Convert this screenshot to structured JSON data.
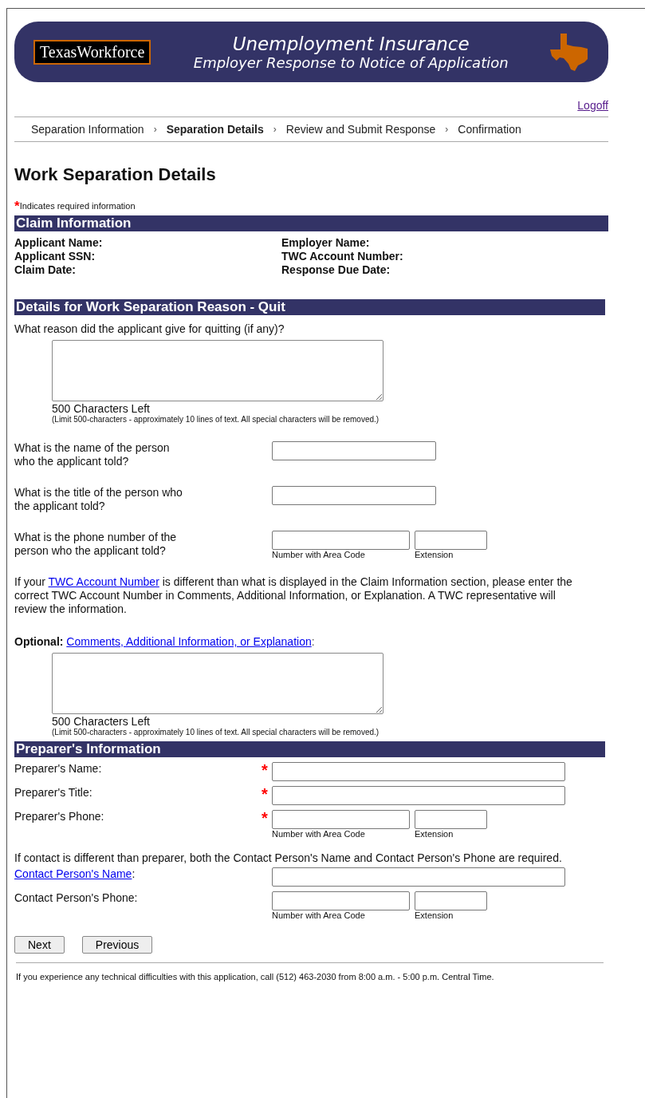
{
  "header": {
    "logo": "TexasWorkforce",
    "title": "Unemployment Insurance",
    "subtitle": "Employer Response to Notice of Application"
  },
  "logoff": "Logoff",
  "steps": [
    {
      "label": "Separation Information",
      "selected": false
    },
    {
      "label": "Separation Details",
      "selected": true
    },
    {
      "label": "Review and Submit Response",
      "selected": false
    },
    {
      "label": "Confirmation",
      "selected": false
    }
  ],
  "step_separator": "›",
  "page_title": "Work Separation Details",
  "required_note": {
    "mark": "*",
    "text": "Indicates required information"
  },
  "claim_info": {
    "heading": "Claim Information",
    "left": [
      "Applicant Name:",
      "Applicant SSN:",
      "Claim Date:"
    ],
    "right": [
      "Employer Name:",
      "TWC Account Number:",
      "Response Due Date:"
    ]
  },
  "quit_section": {
    "heading": "Details for Work Separation Reason - Quit",
    "reason": {
      "label": "What reason did the applicant give for quitting (if any)?",
      "counter": "500 Characters Left",
      "limit": "(Limit 500-characters - approximately 10 lines of text. All special characters will be removed.)"
    },
    "questions": [
      {
        "kind": "text",
        "label": "What is the name of the person who the applicant told?"
      },
      {
        "kind": "text",
        "label": "What is the title of the person who the applicant told?"
      },
      {
        "kind": "phone",
        "label": "What is the phone number of the person who the applicant told?",
        "number_hint": "Number with Area Code",
        "extension_hint": "Extension"
      }
    ],
    "notice": {
      "before": "If your ",
      "link": "TWC Account Number",
      "after": " is different than what is displayed in the Claim Information section, please enter the correct TWC Account Number in Comments, Additional Information, or Explanation. A TWC representative will review the information."
    },
    "optional": {
      "prefix": "Optional:",
      "link": "Comments, Additional Information, or Explanation",
      "suffix": ":",
      "counter": "500 Characters Left",
      "limit": "(Limit 500-characters - approximately 10 lines of text. All special characters will be removed.)"
    }
  },
  "preparer": {
    "heading": "Preparer's Information",
    "required_mark": "*",
    "fields": [
      {
        "kind": "text",
        "label": "Preparer's Name:",
        "link": false,
        "required": true
      },
      {
        "kind": "text",
        "label": "Preparer's Title:",
        "link": false,
        "required": true
      },
      {
        "kind": "phone",
        "label": "Preparer's Phone:",
        "link": false,
        "required": true,
        "number_hint": "Number with Area Code",
        "extension_hint": "Extension"
      }
    ],
    "contact_note": "If contact is different than preparer, both the Contact Person's Name and Contact Person's Phone are required.",
    "contact_fields": [
      {
        "kind": "text",
        "label": "Contact Person's Name",
        "suffix": ":",
        "link": true,
        "required": false
      },
      {
        "kind": "phone",
        "label": "Contact Person's Phone:",
        "link": false,
        "required": false,
        "number_hint": "Number with Area Code",
        "extension_hint": "Extension"
      }
    ]
  },
  "buttons": [
    "Next",
    "Previous"
  ],
  "footer": "If you experience any technical difficulties with this application, call (512) 463-2030 from 8:00 a.m. - 5:00 p.m. Central Time."
}
